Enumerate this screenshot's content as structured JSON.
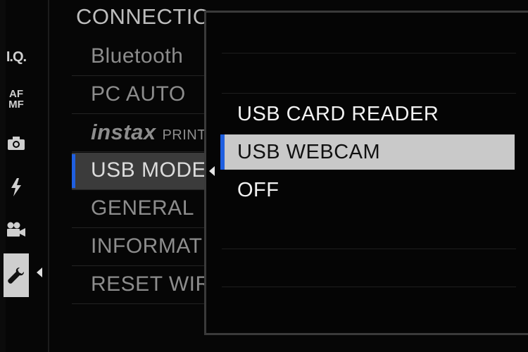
{
  "colors": {
    "accent": "#1f5fe0",
    "highlight": "#c9c9c9",
    "background": "#060606"
  },
  "sidebar": {
    "icons": [
      {
        "name": "iq-icon",
        "label": "I.Q."
      },
      {
        "name": "af-mf-icon",
        "label": "AF MF"
      },
      {
        "name": "camera-icon"
      },
      {
        "name": "flash-icon"
      },
      {
        "name": "movie-icon"
      },
      {
        "name": "wrench-icon",
        "active": true
      }
    ]
  },
  "menu": {
    "title": "CONNECTION SETTING",
    "items": [
      {
        "label": "Bluetooth"
      },
      {
        "label": "PC AUTO"
      },
      {
        "label": "instax",
        "sub": "PRINTER"
      },
      {
        "label": "USB MODE",
        "selected": true
      },
      {
        "label": "GENERAL"
      },
      {
        "label": "INFORMATION"
      },
      {
        "label": "RESET WIRELESS"
      }
    ]
  },
  "popup": {
    "options": [
      {
        "label": "USB CARD READER"
      },
      {
        "label": "USB WEBCAM",
        "selected": true
      },
      {
        "label": "OFF"
      }
    ]
  }
}
